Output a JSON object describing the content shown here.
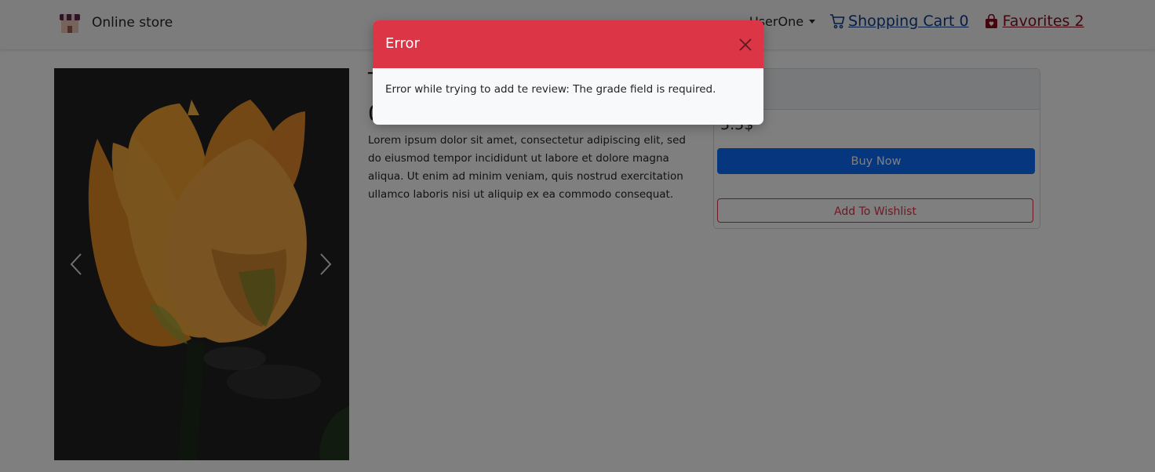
{
  "navbar": {
    "brand": "Online store",
    "user": "UserOne",
    "cart_label": "Shopping Cart 0",
    "favorites_label": "Favorites 2"
  },
  "product": {
    "title": "T",
    "subtitle": "0",
    "description": "Lorem ipsum dolor sit amet, consectetur adipiscing elit, sed do eiusmod tempor incididunt ut labore et dolore magna aliqua. Ut enim ad minim veniam, quis nostrud exercitation ullamco laboris nisi ut aliquip ex ea commodo consequat.",
    "price": "5.5$",
    "buy_label": "Buy Now",
    "wishlist_label": "Add To Wishlist"
  },
  "modal": {
    "title": "Error",
    "message": "Error while trying to add te review: The grade field is required."
  },
  "colors": {
    "danger": "#dc3545",
    "primary": "#0d6efd",
    "cart_link": "#0d3b8c",
    "fav_link": "#8b0a1f"
  },
  "icons": {
    "brand": "store-icon",
    "cart": "cart-icon",
    "favorites": "bag-heart-icon",
    "close": "close-icon",
    "prev": "chevron-left-icon",
    "next": "chevron-right-icon"
  }
}
